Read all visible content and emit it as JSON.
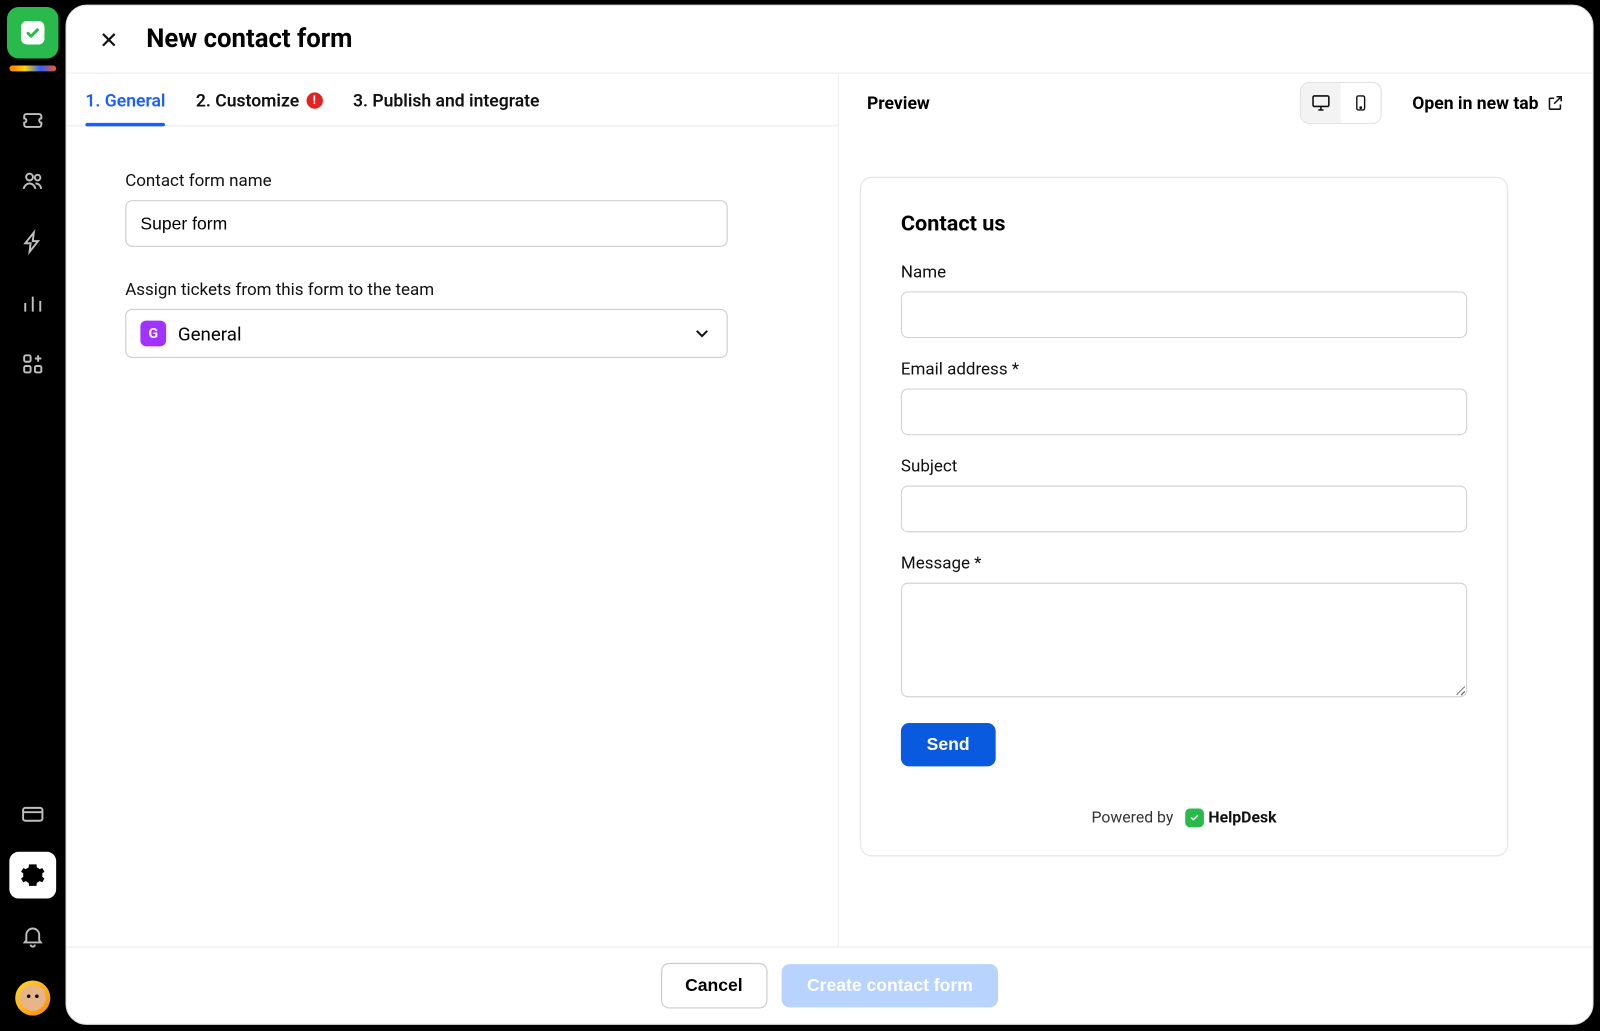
{
  "header": {
    "title": "New contact form"
  },
  "tabs": [
    {
      "label": "1. General",
      "active": true,
      "alert": false
    },
    {
      "label": "2. Customize",
      "active": false,
      "alert": true
    },
    {
      "label": "3. Publish and integrate",
      "active": false,
      "alert": false
    }
  ],
  "form": {
    "name_label": "Contact form name",
    "name_value": "Super form",
    "team_label": "Assign tickets from this form to the team",
    "team_badge": "G",
    "team_value": "General"
  },
  "preview": {
    "title": "Preview",
    "open_label": "Open in new tab",
    "card_title": "Contact us",
    "fields": {
      "name": "Name",
      "email": "Email address *",
      "subject": "Subject",
      "message": "Message *"
    },
    "send_label": "Send",
    "powered_label": "Powered by",
    "brand": "HelpDesk"
  },
  "footer": {
    "cancel": "Cancel",
    "create": "Create contact form"
  }
}
